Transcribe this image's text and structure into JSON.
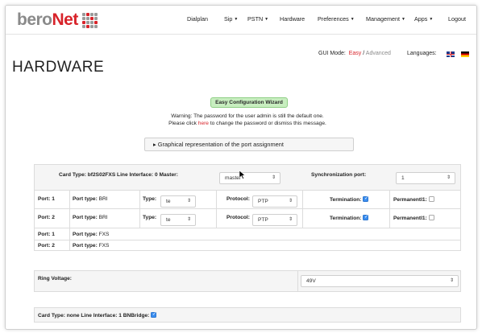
{
  "brand": {
    "bero": "bero",
    "net": "Net"
  },
  "nav": {
    "items": [
      {
        "label": "Dialplan",
        "dropdown": false
      },
      {
        "label": "Sip",
        "dropdown": true
      },
      {
        "label": "PSTN",
        "dropdown": true
      },
      {
        "label": "Hardware",
        "dropdown": false
      },
      {
        "label": "Preferences",
        "dropdown": true
      },
      {
        "label": "Management",
        "dropdown": true
      },
      {
        "label": "Apps",
        "dropdown": true
      },
      {
        "label": "Logout",
        "dropdown": false
      }
    ]
  },
  "header": {
    "gui_mode_label": "GUI Mode:",
    "easy": "Easy",
    "separator": "/",
    "advanced": "Advanced",
    "languages_label": "Languages:",
    "page_title": "HARDWARE"
  },
  "wizard": {
    "label": "Easy Configuration Wizard"
  },
  "warning": {
    "line1": "Warning: The password for the user admin is still the default one.",
    "line2_pre": "Please click ",
    "line2_link": "here",
    "line2_post": " to change the password or dismiss this message."
  },
  "graph_toggle": {
    "arrow": "▸",
    "label": "Graphical representation of the port assignment"
  },
  "card1": {
    "header": "Card Type: bf2S02FXS  Line Interface: 0  Master:",
    "master_value": "master",
    "sync_label": "Synchronization port:",
    "sync_value": "1"
  },
  "bri_ports": [
    {
      "port_label": "Port:",
      "port": "1",
      "type_label": "Port type:",
      "type_value": "BRI",
      "type2_label": "Type:",
      "type2_value": "te",
      "protocol_label": "Protocol:",
      "protocol_value": "PTP",
      "termination_label": "Termination:",
      "termination_checked": true,
      "permanent_label": "Permanentl1:",
      "permanent_checked": false
    },
    {
      "port_label": "Port:",
      "port": "2",
      "type_label": "Port type:",
      "type_value": "BRI",
      "type2_label": "Type:",
      "type2_value": "te",
      "protocol_label": "Protocol:",
      "protocol_value": "PTP",
      "termination_label": "Termination:",
      "termination_checked": true,
      "permanent_label": "Permanentl1:",
      "permanent_checked": false
    }
  ],
  "fxs_ports": [
    {
      "port_label": "Port:",
      "port": "1",
      "type_label": "Port type:",
      "type_value": "FXS"
    },
    {
      "port_label": "Port:",
      "port": "2",
      "type_label": "Port type:",
      "type_value": "FXS"
    }
  ],
  "ring": {
    "label": "Ring Voltage:",
    "value": "49V"
  },
  "card2": {
    "header": "Card Type: none  Line Interface: 1  BNBridge:",
    "bnbridge_checked": true
  },
  "colors": {
    "brand_red": "#d8232a",
    "wizard_green": "#c8eec0",
    "checkbox_blue": "#3b8ef0"
  }
}
